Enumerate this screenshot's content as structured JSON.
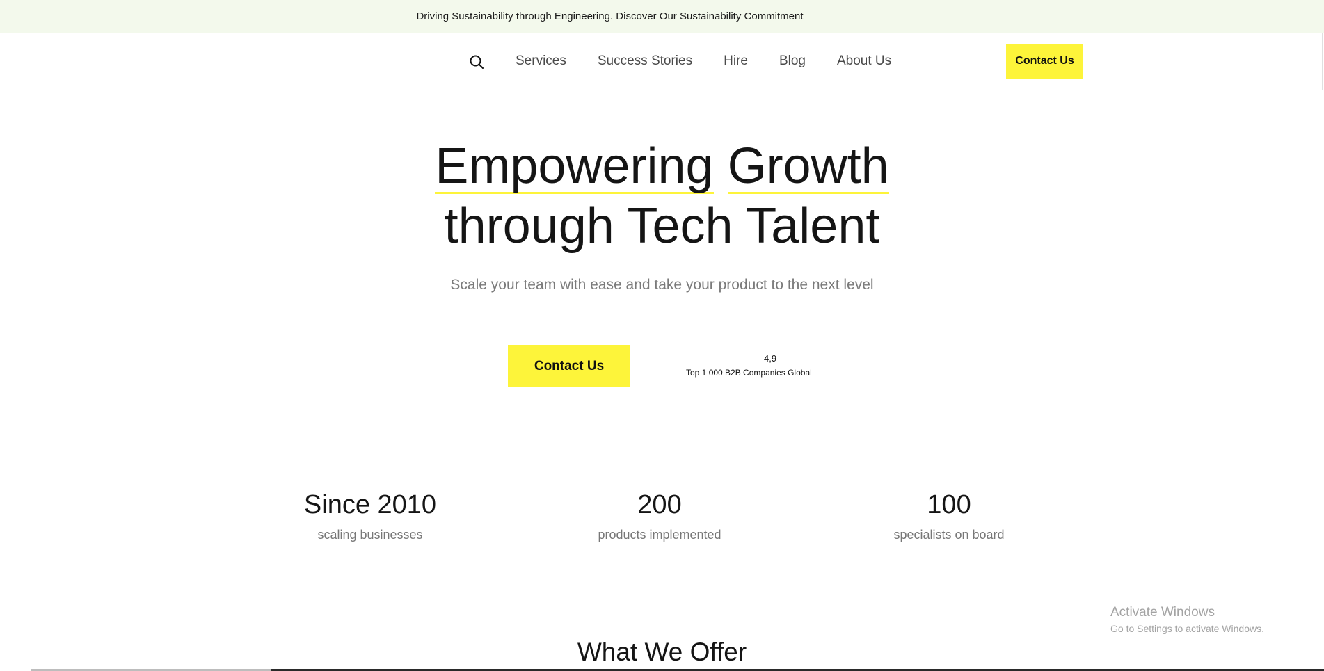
{
  "announcement": {
    "text": "Driving Sustainability through Engineering. Discover Our Sustainability Commitment"
  },
  "header": {
    "search_icon": "search-icon",
    "nav": [
      {
        "label": "Services"
      },
      {
        "label": "Success Stories"
      },
      {
        "label": "Hire"
      },
      {
        "label": "Blog"
      },
      {
        "label": "About Us"
      }
    ],
    "cta_label": "Contact Us"
  },
  "hero": {
    "title_word1": "Empowering",
    "title_word2": "Growth",
    "title_line2": "through Tech Talent",
    "subtitle": "Scale your team with ease and take your product to the next level",
    "cta_label": "Contact Us",
    "rating_value": "4,9",
    "rating_label": "Top 1 000 B2B Companies Global"
  },
  "stats": [
    {
      "number": "Since 2010",
      "label": "scaling businesses"
    },
    {
      "number": "200",
      "label": "products implemented"
    },
    {
      "number": "100",
      "label": "specialists on board"
    }
  ],
  "next_section": {
    "title": "What We Offer"
  },
  "os_watermark": {
    "line1": "Activate Windows",
    "line2": "Go to Settings to activate Windows."
  },
  "colors": {
    "accent": "#fdf43a",
    "announcement_bg": "#f3f9ec",
    "text": "#151515",
    "muted": "#777777"
  }
}
